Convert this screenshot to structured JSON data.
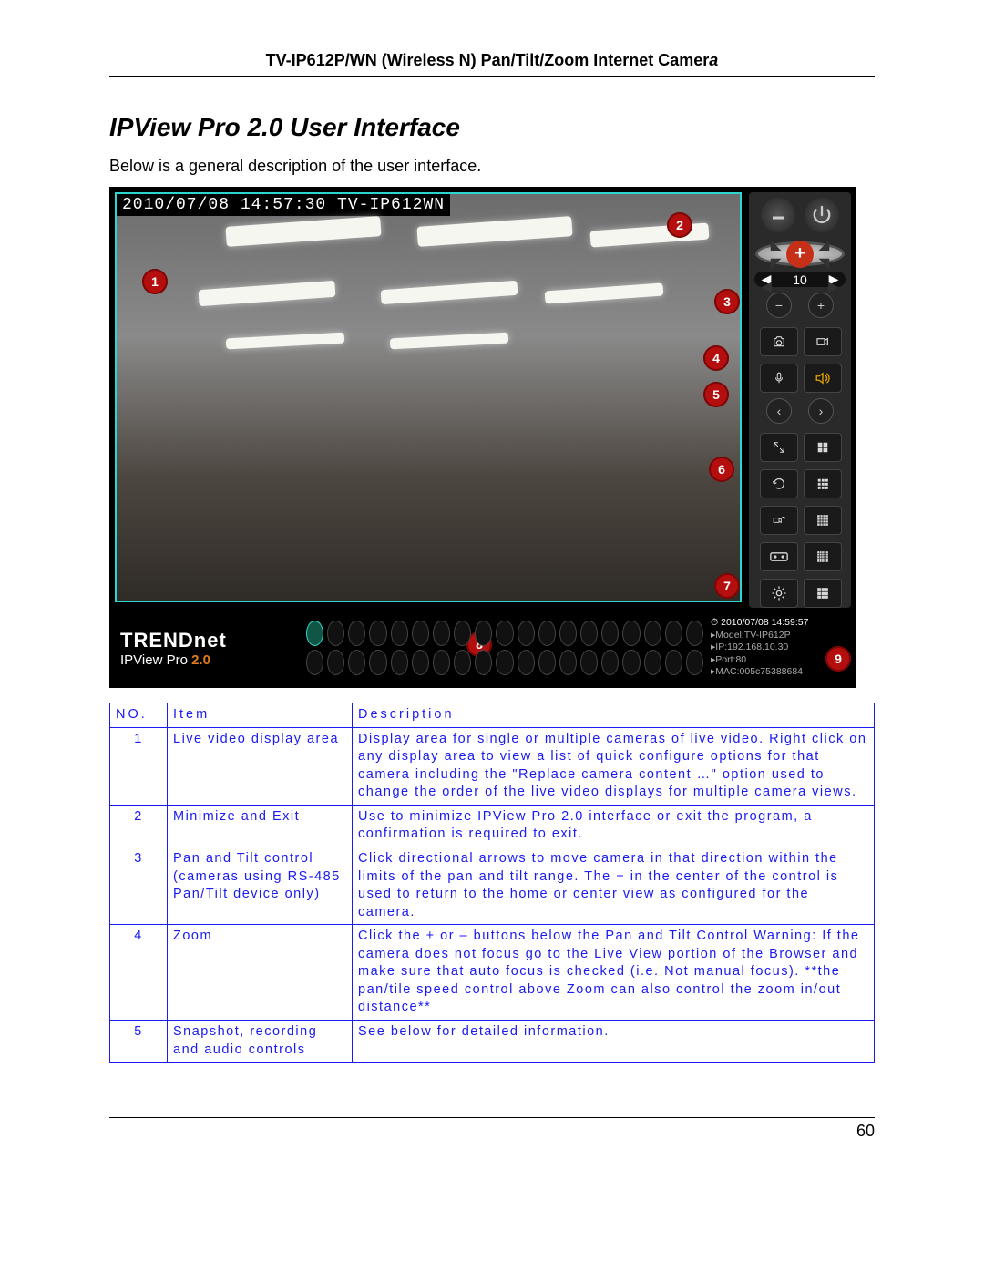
{
  "chart_data": {
    "type": "table",
    "columns": [
      "NO.",
      "Item",
      "Description"
    ],
    "rows": [
      {
        "no": "1",
        "item": "Live video display area",
        "desc": "Display area for single or multiple cameras of live video. Right click on any display area to view a list of quick configure options for that camera including the \"Replace camera content …\" option used to change the order of the live video displays for multiple camera views."
      },
      {
        "no": "2",
        "item": "Minimize and Exit",
        "desc": "Use to minimize IPView Pro 2.0 interface or exit the program, a confirmation is required to exit."
      },
      {
        "no": "3",
        "item": "Pan and Tilt control (cameras using RS-485 Pan/Tilt device only)",
        "desc": "Click directional arrows to move camera in that direction within the limits of the pan and tilt range. The + in the center of the control is used to return to the home or center view as configured for the camera."
      },
      {
        "no": "4",
        "item": "Zoom",
        "desc": "Click the + or – buttons below the Pan and Tilt Control Warning: If the camera does not focus go to the Live View portion of the Browser and make sure that auto focus is checked (i.e. Not manual focus). **the pan/tile speed control above Zoom can also control the zoom in/out distance**"
      },
      {
        "no": "5",
        "item": "Snapshot, recording and audio controls",
        "desc": "See below for detailed information."
      }
    ]
  },
  "header": {
    "title_main": "TV-IP612P/WN (Wireless N) Pan/Tilt/Zoom Internet Camer",
    "title_suffix": "a"
  },
  "section_title": "IPView Pro 2.0 User Interface",
  "intro": "Below is a general description of the user interface.",
  "osd": "2010/07/08 14:57:30 TV-IP612WN",
  "markers": {
    "m1": "1",
    "m2": "2",
    "m3": "3",
    "m4": "4",
    "m5": "5",
    "m6": "6",
    "m7": "7",
    "m8": "8",
    "m9": "9"
  },
  "zoom_value": "10",
  "logo": {
    "brand": "TRENDnet",
    "product": "IPView Pro ",
    "ver": "2.0"
  },
  "info_panel": {
    "datetime": "2010/07/08 14:59:57",
    "model_lbl": "Model:",
    "model": "TV-IP612P",
    "ip_lbl": "IP:",
    "ip": "192.168.10.30",
    "port_lbl": "Port:",
    "port": "80",
    "mac_lbl": "MAC:",
    "mac": "005c75388684"
  },
  "table": {
    "head": {
      "no": "NO.",
      "item": "Item",
      "desc": "Description"
    }
  },
  "page_number": "60"
}
